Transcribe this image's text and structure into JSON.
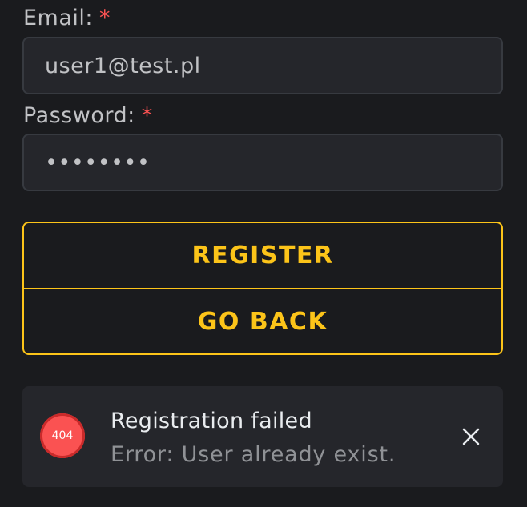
{
  "form": {
    "email": {
      "label": "Email:",
      "required_mark": "*",
      "value": "user1@test.pl"
    },
    "password": {
      "label": "Password:",
      "required_mark": "*",
      "value": "••••••••"
    }
  },
  "buttons": {
    "register_label": "REGISTER",
    "go_back_label": "GO BACK"
  },
  "notification": {
    "icon_name": "error-code-icon",
    "code": "404",
    "title": "Registration failed",
    "message": "Error: User already exist.",
    "close_icon": "close-icon"
  },
  "colors": {
    "background": "#1a1b1e",
    "accent": "#fcc419",
    "error": "#fa5252",
    "input_background": "#25262b"
  }
}
